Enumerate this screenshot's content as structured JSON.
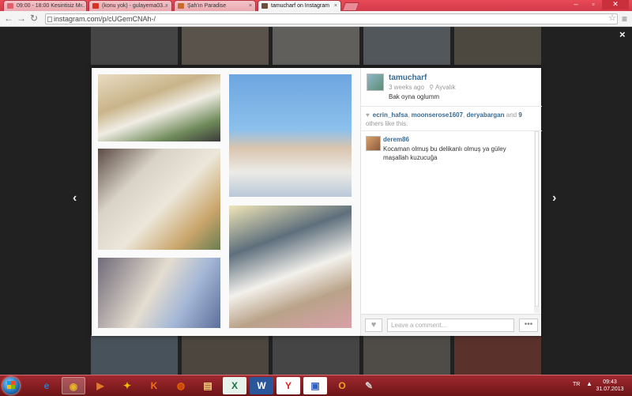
{
  "browser": {
    "tabs": [
      {
        "label": "09:00 - 18:00 Kesintisiz M...",
        "active": false,
        "favicon_color": "#e0606c"
      },
      {
        "label": "(konu yok) - gulayema03...",
        "active": false,
        "favicon_color": "#d93025"
      },
      {
        "label": "Şah'ın Paradise",
        "active": false,
        "favicon_color": "#c76b2d"
      },
      {
        "label": "tamucharf on Instagram",
        "active": true,
        "favicon_color": "#6b4f3a"
      }
    ],
    "url": "instagram.com/p/cUGemCNAh-/",
    "window_buttons": {
      "minimize": "–",
      "maximize": "▫",
      "close": "✕"
    },
    "icons": {
      "back": "back-arrow-icon",
      "forward": "forward-arrow-icon",
      "reload": "reload-icon",
      "star": "star-icon",
      "menu": "menu-icon"
    }
  },
  "overlay": {
    "close_label": "×",
    "prev_label": "‹",
    "next_label": "›"
  },
  "post": {
    "username": "tamucharf",
    "time_ago": "3 weeks ago",
    "location": "Ayvalık",
    "caption": "Bak oyna oglumm",
    "likes": {
      "users": [
        "ecrin_hafsa",
        "moonserose1607",
        "deryabargan"
      ],
      "and_label": "and",
      "count": "9",
      "suffix": "others like this."
    },
    "comments": [
      {
        "user": "derem86",
        "text": "Kocaman olmuş bu delikanlı olmuş ya güley maşallah kuzucuğa"
      }
    ],
    "comment_placeholder": "Leave a comment...",
    "more_label": "•••",
    "like_button": "♥"
  },
  "taskbar": {
    "apps": [
      {
        "name": "internet-explorer",
        "label": "e",
        "color": "#2b7cd3",
        "active": false
      },
      {
        "name": "chrome",
        "label": "◉",
        "color": "#e8b42c",
        "active": true
      },
      {
        "name": "media-player",
        "label": "▶",
        "color": "#e07a2c",
        "active": false
      },
      {
        "name": "game",
        "label": "✦",
        "color": "#f0c000",
        "active": false
      },
      {
        "name": "k-app",
        "label": "K",
        "color": "#f07020",
        "active": false
      },
      {
        "name": "firefox",
        "label": "◍",
        "color": "#e66000",
        "active": false
      },
      {
        "name": "folder",
        "label": "▤",
        "color": "#f3d27a",
        "active": false
      },
      {
        "name": "excel",
        "label": "X",
        "color": "#1e7145",
        "active": false
      },
      {
        "name": "word",
        "label": "W",
        "color": "#2b579a",
        "active": false
      },
      {
        "name": "yandex",
        "label": "Y",
        "color": "#e02020",
        "active": false
      },
      {
        "name": "app-blue",
        "label": "▣",
        "color": "#3060c0",
        "active": false
      },
      {
        "name": "outlook",
        "label": "O",
        "color": "#f0a020",
        "active": false
      },
      {
        "name": "paint",
        "label": "✎",
        "color": "#d0d0d0",
        "active": false
      }
    ],
    "language": "TR",
    "time": "09:43",
    "date": "31.07.2013"
  }
}
